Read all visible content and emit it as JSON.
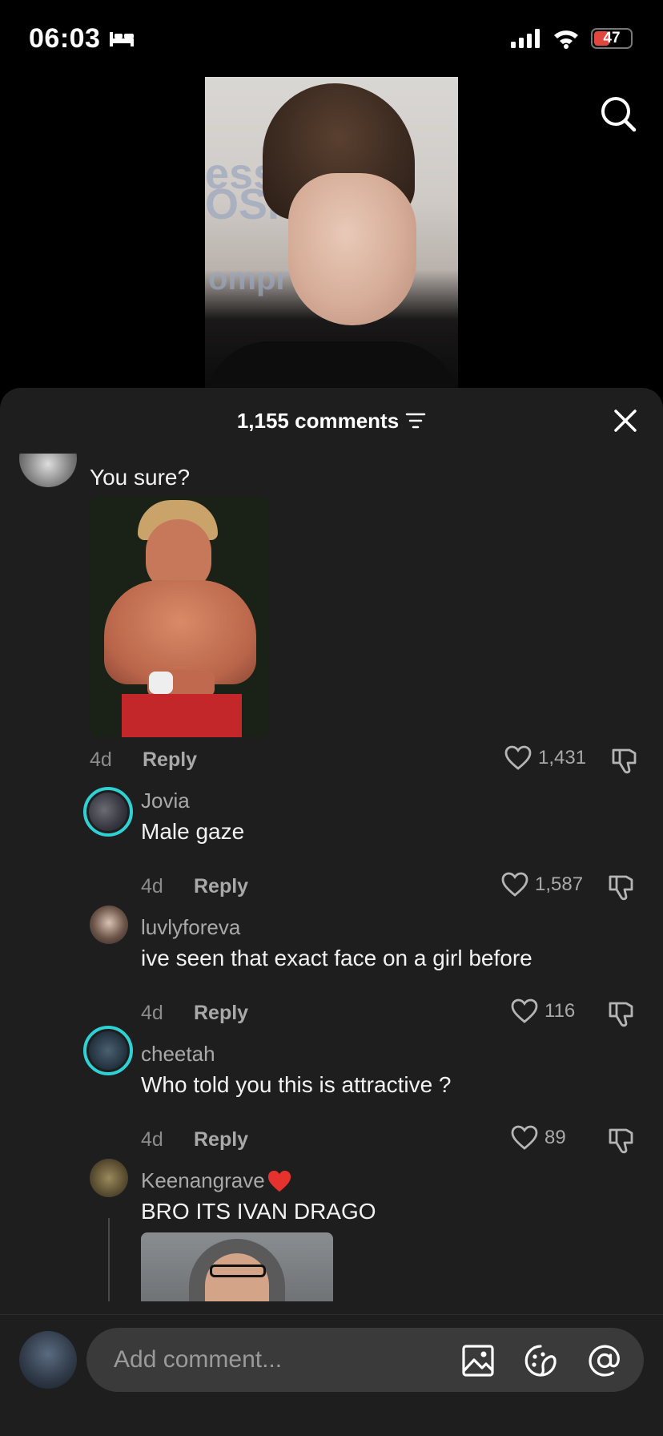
{
  "status_bar": {
    "time": "06:03",
    "battery": "47"
  },
  "sheet": {
    "title": "1,155 comments"
  },
  "comments": [
    {
      "id": "c0",
      "text": "You sure?",
      "age": "4d",
      "reply_label": "Reply",
      "likes": "1,431",
      "has_image": true
    },
    {
      "id": "c1",
      "username": "Jovia",
      "text": "Male gaze",
      "age": "4d",
      "reply_label": "Reply",
      "likes": "1,587",
      "ring": true
    },
    {
      "id": "c2",
      "username": "luvlyforeva",
      "text": "ive seen that exact face on a girl before",
      "age": "4d",
      "reply_label": "Reply",
      "likes": "116",
      "ring": false
    },
    {
      "id": "c3",
      "username": "cheetah",
      "text": "Who told you this is attractive ?",
      "age": "4d",
      "reply_label": "Reply",
      "likes": "89",
      "ring": true
    },
    {
      "id": "c4",
      "username": "Keenangrave",
      "text": "BRO ITS IVAN DRAGO",
      "has_image": true
    }
  ],
  "composer": {
    "placeholder": "Add comment..."
  },
  "icons": {
    "status": [
      "sleep-icon",
      "signal-icon",
      "wifi-icon",
      "battery-icon"
    ],
    "top": [
      "search-icon"
    ],
    "sheet": [
      "sort-icon",
      "close-icon"
    ],
    "comment": [
      "heart-icon",
      "dislike-icon"
    ],
    "composer": [
      "image-icon",
      "sticker-icon",
      "mention-icon"
    ]
  },
  "colors": {
    "ring": "#2fd1d4",
    "sheet_bg": "#1e1e1e",
    "heart_emoji": "#e5322d"
  }
}
